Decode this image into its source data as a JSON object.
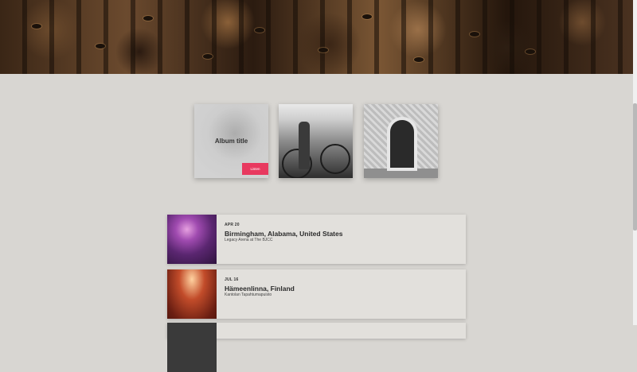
{
  "hero": {
    "image": "honeycomb-bees-photo"
  },
  "albums": [
    {
      "title": "Album title",
      "button": "Listen",
      "image": "gray-knot-photo"
    },
    {
      "image": "bicycle-rickshaw-photo"
    },
    {
      "image": "moroccan-doorway-photo"
    }
  ],
  "events": [
    {
      "date": "APR 20",
      "city": "Birmingham, Alabama, United States",
      "venue": "Legacy Arena at The BJCC",
      "image": "concert-stage-purple"
    },
    {
      "date": "JUL 16",
      "city": "Hämeenlinna, Finland",
      "venue": "Kantolan Tapahtumapuisto",
      "image": "concert-crowd-red"
    }
  ],
  "colors": {
    "background": "#d8d6d2",
    "accent": "#e8395f",
    "card": "#e2e0dc"
  }
}
